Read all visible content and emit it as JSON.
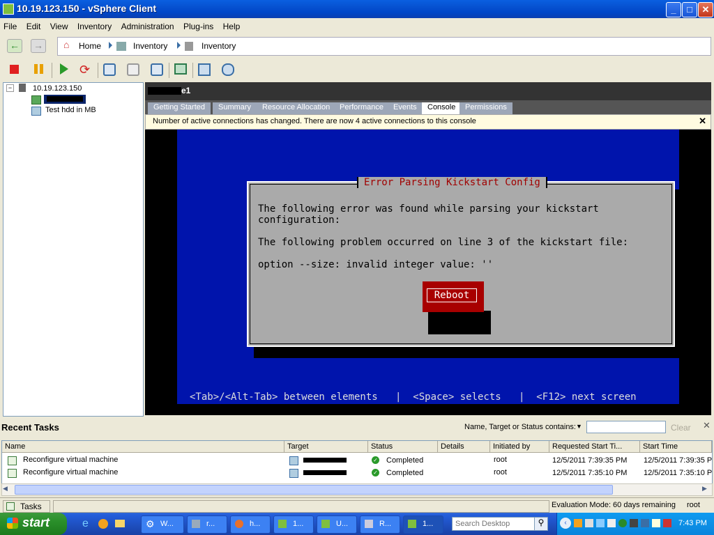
{
  "window": {
    "title": "10.19.123.150 - vSphere Client",
    "controls": {
      "minimize": "_",
      "maximize": "□",
      "close": "✕"
    }
  },
  "menu": [
    "File",
    "Edit",
    "View",
    "Inventory",
    "Administration",
    "Plug-ins",
    "Help"
  ],
  "nav": {
    "back_icon": "back-arrow-icon",
    "forward_icon": "forward-arrow-icon",
    "breadcrumbs": [
      "Home",
      "Inventory",
      "Inventory"
    ]
  },
  "toolbar_icons": [
    "stop-icon",
    "pause-icon",
    "play-icon",
    "reset-icon",
    "snapshot-icon",
    "revert-snapshot-icon",
    "snapshot-manager-icon",
    "console-icon",
    "edit-settings-icon",
    "connect-device-icon"
  ],
  "tree": {
    "host": "10.19.123.150",
    "vms": [
      "Test hdd in MB"
    ]
  },
  "vm": {
    "name_suffix": "e1",
    "tabs": [
      "Getting Started",
      "Summary",
      "Resource Allocation",
      "Performance",
      "Events",
      "Console",
      "Permissions"
    ],
    "active_tab": "Console",
    "notice": "Number of active connections has changed. There are now 4 active connections to this console"
  },
  "console": {
    "dialog_title": "Error Parsing Kickstart Config",
    "line1": "The following error was found while parsing your kickstart",
    "line2": "configuration:",
    "line3": "The following problem occurred on line 3 of the kickstart file:",
    "line4": "option --size: invalid integer value: ''",
    "button": "Reboot",
    "help": "<Tab>/<Alt-Tab> between elements   |  <Space> selects   |  <F12> next screen"
  },
  "recent_tasks": {
    "title": "Recent Tasks",
    "filter_label": "Name, Target or Status contains:",
    "filter_value": "",
    "clear_label": "Clear",
    "columns": [
      "Name",
      "Target",
      "Status",
      "Details",
      "Initiated by",
      "Requested Start Ti...",
      "Start Time"
    ],
    "rows": [
      {
        "name": "Reconfigure virtual machine",
        "status": "Completed",
        "initiated_by": "root",
        "requested": "12/5/2011 7:39:35 PM",
        "start": "12/5/2011 7:39:35 P"
      },
      {
        "name": "Reconfigure virtual machine",
        "status": "Completed",
        "initiated_by": "root",
        "requested": "12/5/2011 7:35:10 PM",
        "start": "12/5/2011 7:35:10 P"
      }
    ]
  },
  "statusbar": {
    "tasks_label": "Tasks",
    "evaluation": "Evaluation Mode: 60 days remaining",
    "user": "root"
  },
  "taskbar": {
    "start_label": "start",
    "tasks": [
      "W...",
      "r...",
      "h...",
      "1...",
      "U...",
      "R...",
      "1..."
    ],
    "search_placeholder": "Search Desktop",
    "clock": "7:43 PM"
  }
}
